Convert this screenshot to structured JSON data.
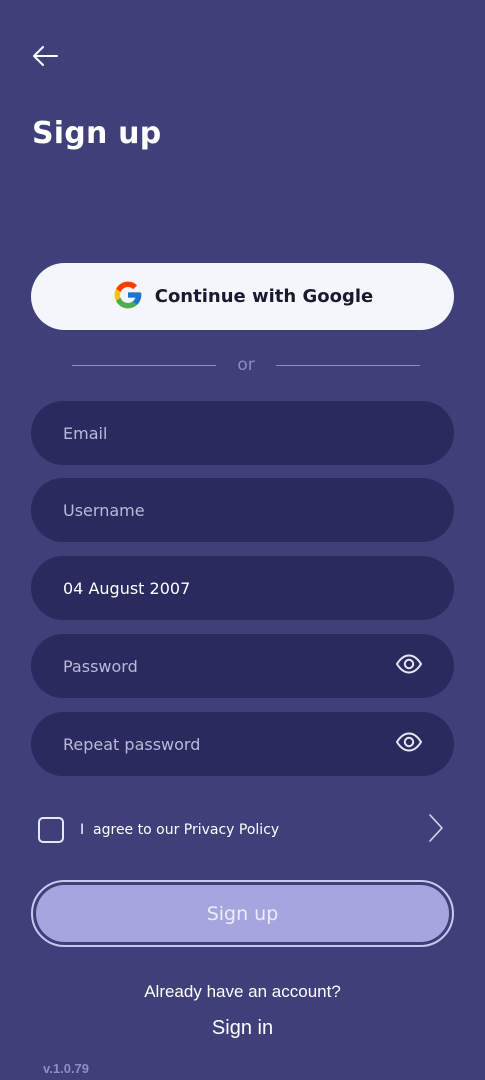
{
  "header": {
    "back_icon": "arrow-left-icon",
    "title": "Sign up"
  },
  "google": {
    "icon": "google-logo-icon",
    "label": "Continue with Google"
  },
  "divider": {
    "text": "or"
  },
  "fields": {
    "email": {
      "placeholder": "Email",
      "value": ""
    },
    "username": {
      "placeholder": "Username",
      "value": ""
    },
    "birthdate": {
      "placeholder": "",
      "value": "04 August 2007"
    },
    "password": {
      "placeholder": "Password",
      "value": "",
      "toggle_icon": "eye-icon"
    },
    "repeat_password": {
      "placeholder": "Repeat password",
      "value": "",
      "toggle_icon": "eye-icon"
    }
  },
  "agreement": {
    "label": "I  agree to our Privacy Policy",
    "checked": false,
    "chevron_icon": "chevron-right-icon"
  },
  "signup_button": {
    "label": "Sign up"
  },
  "footer": {
    "already_text": "Already have an account?",
    "signin_label": "Sign in",
    "version": "v.1.0.79"
  },
  "colors": {
    "background": "#3f3f7a",
    "field_background": "#2b2a5e",
    "google_button_background": "#f4f6fb",
    "signup_button_fill": "#a6a5dd",
    "signup_button_border": "#c9c8ef",
    "divider": "#8e8ec4",
    "version_text": "#8e8ec2"
  }
}
